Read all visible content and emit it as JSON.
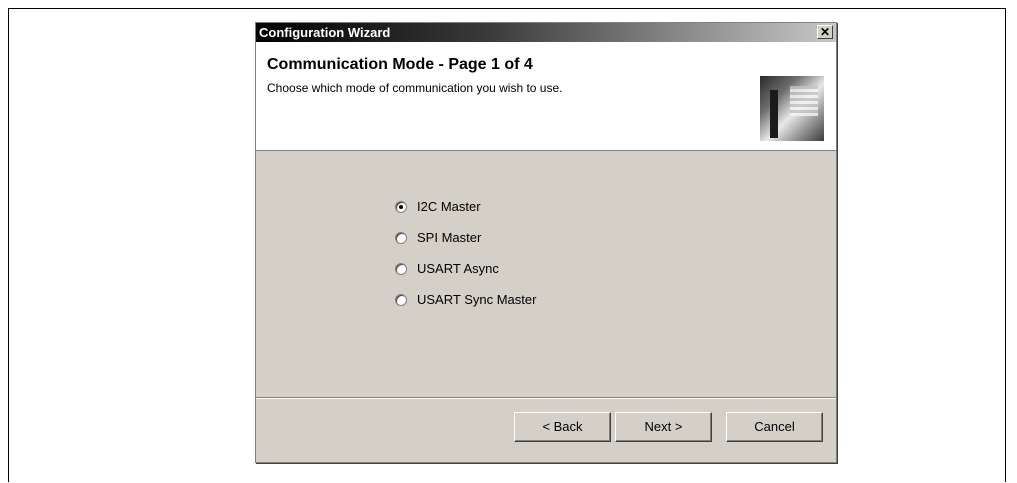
{
  "window": {
    "title": "Configuration Wizard",
    "close_glyph": "✕"
  },
  "header": {
    "heading": "Communication Mode - Page 1 of 4",
    "subtitle": "Choose which mode of communication you wish to use."
  },
  "options": [
    {
      "label": "I2C Master",
      "selected": true
    },
    {
      "label": "SPI Master",
      "selected": false
    },
    {
      "label": "USART Async",
      "selected": false
    },
    {
      "label": "USART Sync Master",
      "selected": false
    }
  ],
  "buttons": {
    "back": "< Back",
    "next": "Next >",
    "cancel": "Cancel"
  }
}
